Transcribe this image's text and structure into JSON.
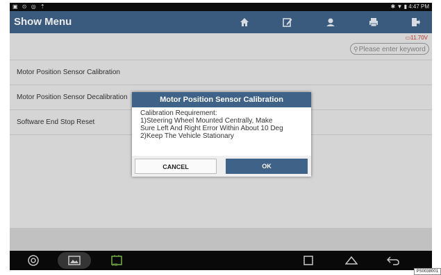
{
  "status_bar": {
    "left_icons": "▣ ⊙ ◎ ⇡",
    "right_text": "✱ ▼ ▮ 4:47 PM"
  },
  "header": {
    "title": "Show Menu",
    "icons": [
      "home-icon",
      "edit-icon",
      "user-icon",
      "print-icon",
      "exit-icon"
    ]
  },
  "battery_voltage": "11.70V",
  "search": {
    "placeholder": "Please enter keyword"
  },
  "menu_items": [
    "Motor Position Sensor Calibration",
    "Motor Position Sensor Decalibration",
    "Software End Stop Reset"
  ],
  "dialog": {
    "title": "Motor Position Sensor Calibration",
    "lines": [
      "Calibration Requirement:",
      "1)Steering Wheel Mounted Centrally, Make",
      "Sure Left And Right Error Within About 10 Deg",
      "2)Keep The Vehicle Stationary"
    ],
    "cancel_label": "CANCEL",
    "ok_label": "OK"
  },
  "nav_bar": {
    "vci_label": "VCI"
  },
  "figure_ref": "PS0038001",
  "colors": {
    "header_blue": "#3f6388",
    "voltage_red": "#c0392b"
  }
}
